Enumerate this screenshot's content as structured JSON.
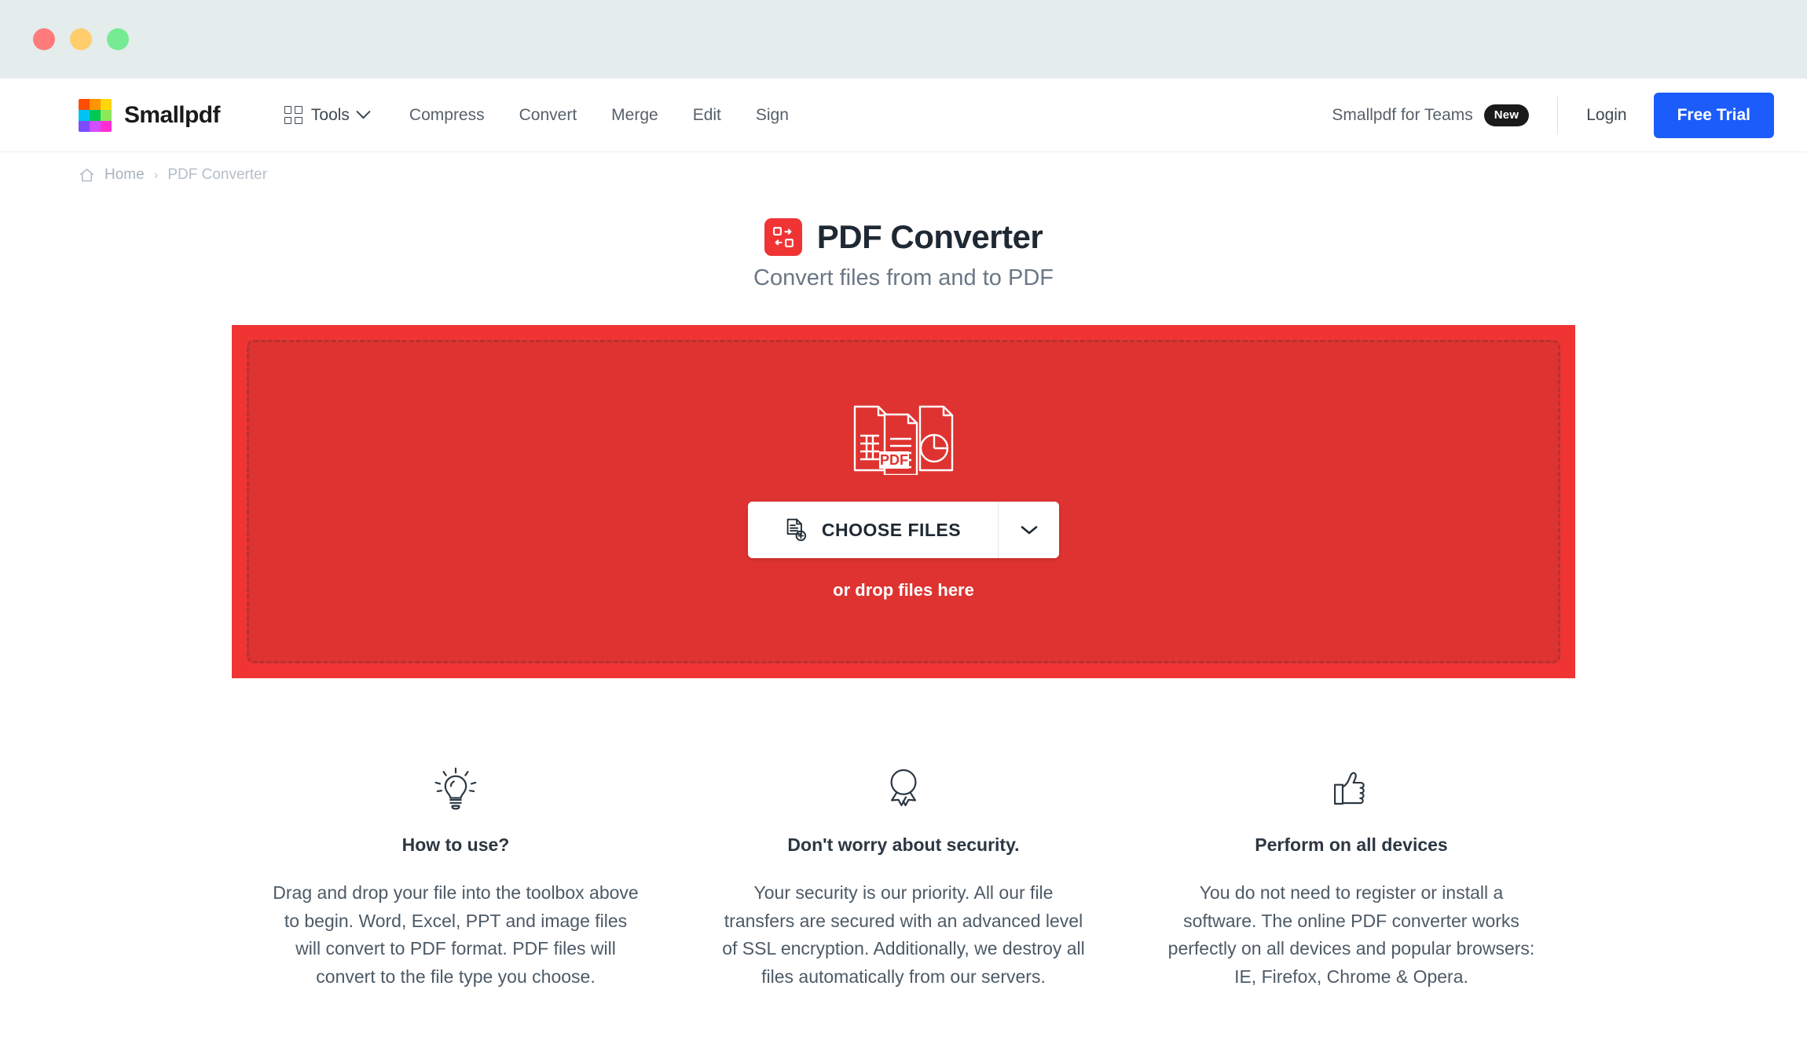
{
  "window": {
    "traffic_lights": [
      "close",
      "minimize",
      "maximize"
    ]
  },
  "header": {
    "brand_name": "Smallpdf",
    "brand_colors": [
      "#ff4d00",
      "#ff9500",
      "#ffd60a",
      "#00c2f5",
      "#00c853",
      "#8ce85a",
      "#7c4dff",
      "#d44dff",
      "#ff2ed4"
    ],
    "tools_label": "Tools",
    "nav_links": [
      "Compress",
      "Convert",
      "Merge",
      "Edit",
      "Sign"
    ],
    "teams_label": "Smallpdf for Teams",
    "teams_badge": "New",
    "login_label": "Login",
    "trial_label": "Free Trial",
    "trial_color": "#1b5cfa"
  },
  "breadcrumb": {
    "home": "Home",
    "separator": "›",
    "current": "PDF Converter"
  },
  "page": {
    "title": "PDF Converter",
    "subtitle": "Convert files from and to PDF",
    "accent_color": "#f03434"
  },
  "dropzone": {
    "choose_label": "CHOOSE FILES",
    "drop_hint": "or drop files here",
    "pdf_badge": "PDF",
    "bg_color": "#f03434",
    "inner_color": "#de3330"
  },
  "features": [
    {
      "icon": "lightbulb-icon",
      "title": "How to use?",
      "body": "Drag and drop your file into the toolbox above to begin. Word, Excel, PPT and image files will convert to PDF format. PDF files will convert to the file type you choose."
    },
    {
      "icon": "award-ribbon-icon",
      "title": "Don't worry about security.",
      "body": "Your security is our priority. All our file transfers are secured with an advanced level of SSL encryption. Additionally, we destroy all files automatically from our servers."
    },
    {
      "icon": "thumbs-up-icon",
      "title": "Perform on all devices",
      "body": "You do not need to register or install a software. The online PDF converter works perfectly on all devices and popular browsers: IE, Firefox, Chrome & Opera."
    }
  ]
}
